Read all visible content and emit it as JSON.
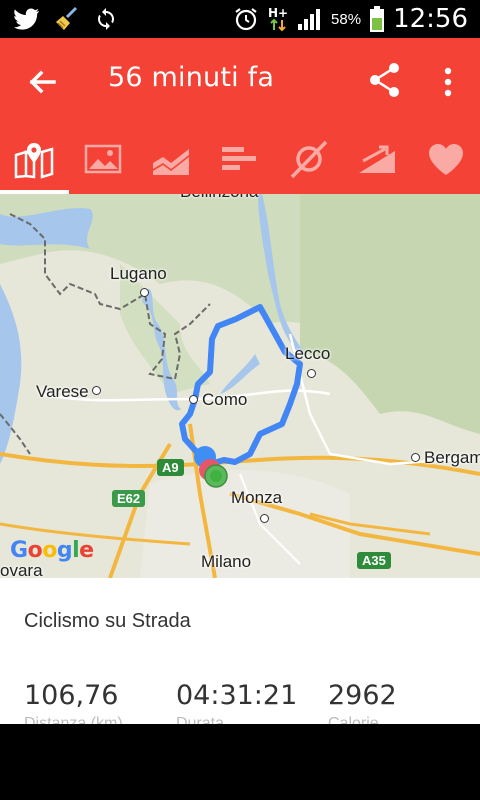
{
  "status_bar": {
    "icons_left": [
      "twitter-icon",
      "broom-icon",
      "sync-icon"
    ],
    "icons_right": [
      "alarm-icon",
      "h-plus-data-icon",
      "signal-icon",
      "battery-icon"
    ],
    "battery_percent": "58%",
    "time": "12:56"
  },
  "toolbar": {
    "title": "56 minuti fa",
    "back_icon": "arrow-back-icon",
    "share_icon": "share-icon",
    "more_icon": "more-vert-icon"
  },
  "tabs": [
    {
      "icon": "map-pin-icon",
      "selected": true
    },
    {
      "icon": "photo-icon",
      "selected": false
    },
    {
      "icon": "area-chart-icon",
      "selected": false
    },
    {
      "icon": "bars-icon",
      "selected": false
    },
    {
      "icon": "route-icon",
      "selected": false
    },
    {
      "icon": "trending-up-icon",
      "selected": false
    },
    {
      "icon": "heart-icon",
      "selected": false
    }
  ],
  "map": {
    "cities": {
      "bellinzona": "Bellinzona",
      "lugano": "Lugano",
      "varese": "Varese",
      "como": "Como",
      "lecco": "Lecco",
      "bergamo": "Bergam",
      "monza": "Monza",
      "milano": "Milano",
      "novara": "ovara"
    },
    "road_shields": {
      "a9": "A9",
      "e62": "E62",
      "a35": "A35"
    },
    "google": "Google",
    "route_color": "#4285f4"
  },
  "details": {
    "activity_type": "Ciclismo su Strada",
    "stats": [
      {
        "value": "106,76",
        "label": "Distanza (km)"
      },
      {
        "value": "04:31:21",
        "label": "Durata"
      },
      {
        "value": "2962",
        "label": "Calorie"
      }
    ]
  },
  "colors": {
    "accent": "#f44336",
    "status_bar": "#000000"
  }
}
